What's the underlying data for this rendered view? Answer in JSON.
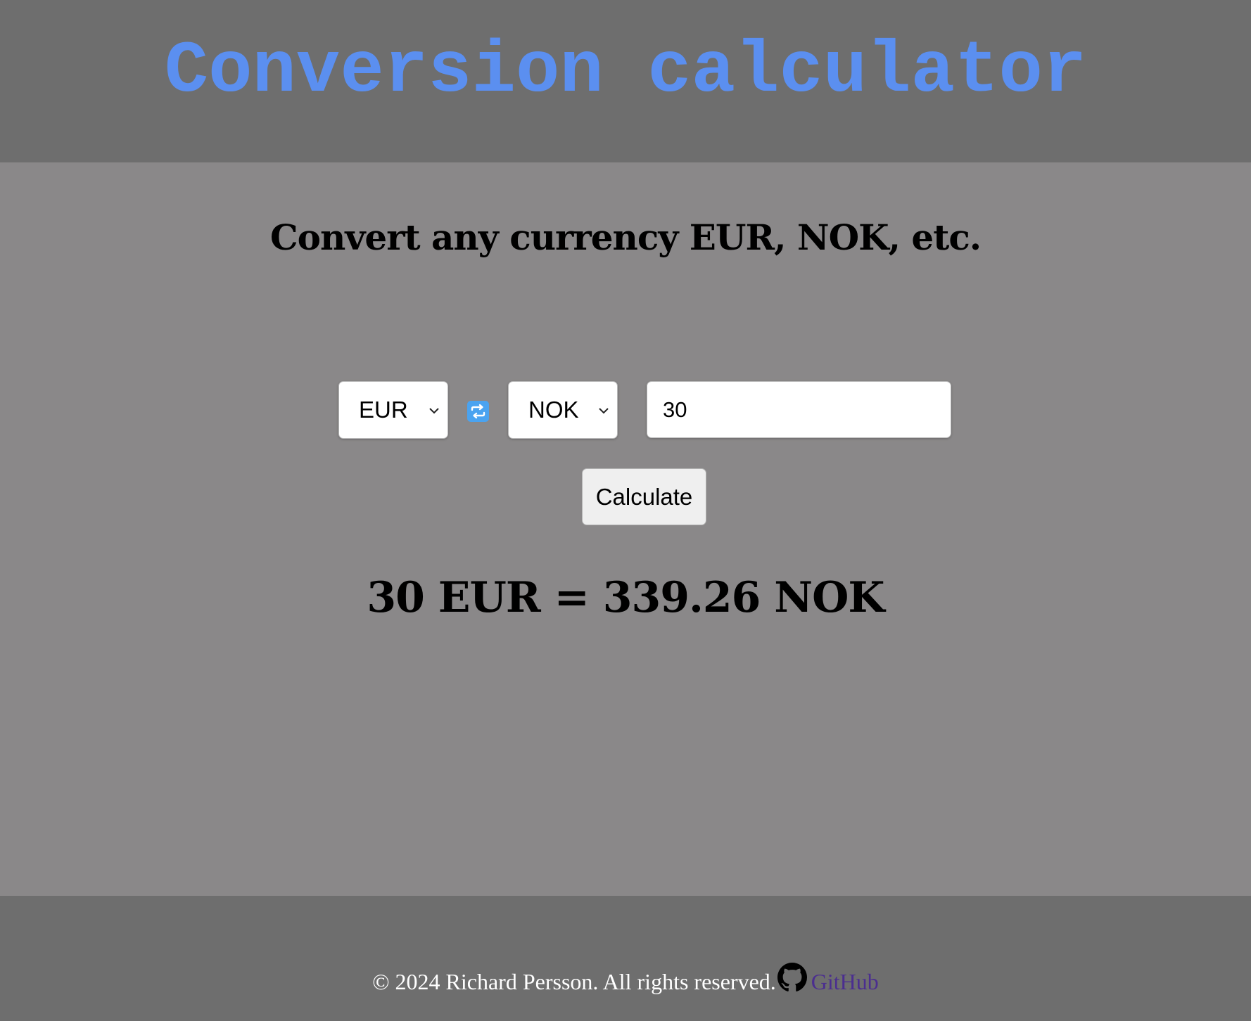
{
  "header": {
    "title": "Conversion calculator"
  },
  "main": {
    "subtitle": "Convert any currency EUR, NOK, etc.",
    "from_currency": "EUR",
    "to_currency": "NOK",
    "amount": "30",
    "calculate_label": "Calculate",
    "result": "30 EUR = 339.26 NOK"
  },
  "footer": {
    "copyright": "© 2024 Richard Persson. All rights reserved.",
    "github_label": "GitHub"
  },
  "icons": {
    "swap": "swap-arrows-icon",
    "github": "github-icon",
    "chevron": "chevron-down-icon"
  },
  "colors": {
    "header_bg": "#6e6e6e",
    "main_bg": "#8a8889",
    "title": "#5b8ff0",
    "swap_button": "#4aa3f0",
    "link": "#4b2e8f"
  }
}
